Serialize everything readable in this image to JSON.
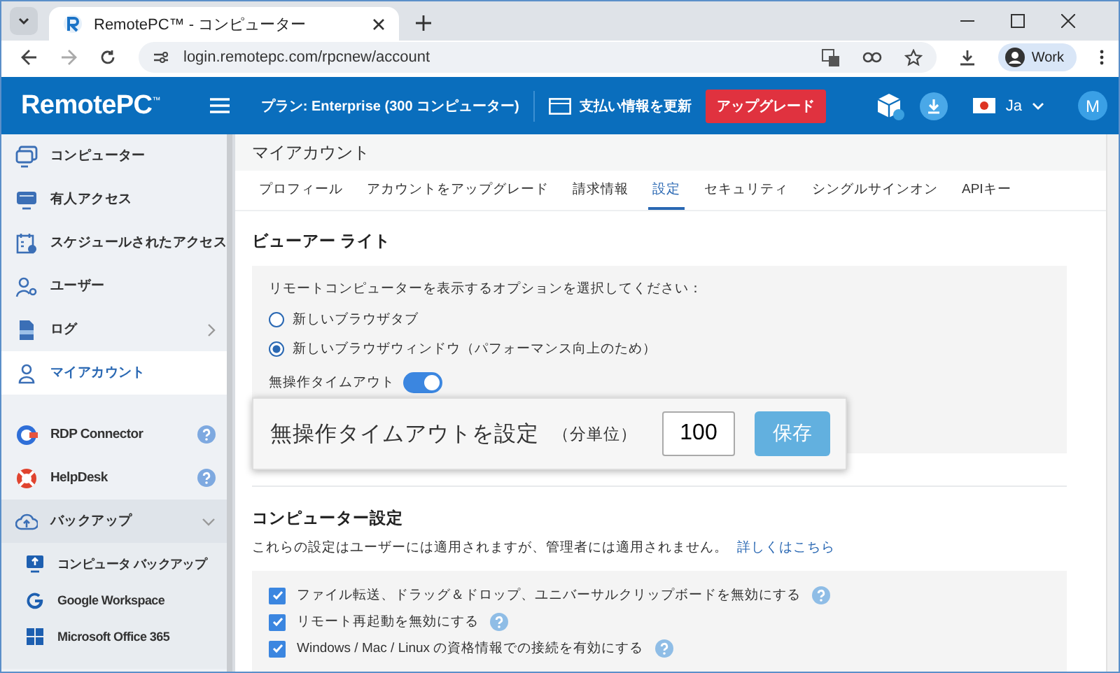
{
  "browser": {
    "tab_title": "RemotePC™ - コンピューター",
    "url": "login.remotepc.com/rpcnew/account",
    "profile": "Work"
  },
  "header": {
    "logo": "RemotePC",
    "logo_mark": "™",
    "plan": "プラン: Enterprise (300 コンピューター)",
    "billing": "支払い情報を更新",
    "upgrade": "アップグレード",
    "language": "Ja",
    "avatar": "M"
  },
  "sidebar": {
    "items": [
      {
        "label": "コンピューター",
        "selected": false
      },
      {
        "label": "有人アクセス",
        "selected": false
      },
      {
        "label": "スケジュールされたアクセス",
        "selected": false
      },
      {
        "label": "ユーザー",
        "selected": false
      },
      {
        "label": "ログ",
        "selected": false,
        "expanded": false
      },
      {
        "label": "マイアカウント",
        "selected": true
      },
      {
        "label": "RDP Connector",
        "selected": false,
        "help": true
      },
      {
        "label": "HelpDesk",
        "selected": false,
        "help": true
      },
      {
        "label": "バックアップ",
        "selected": false,
        "expanded": true,
        "children": [
          {
            "label": "コンピュータ バックアップ",
            "selected": false
          },
          {
            "label": "Google Workspace",
            "selected": false
          },
          {
            "label": "Microsoft Office 365",
            "selected": false
          }
        ]
      }
    ]
  },
  "page_title": "マイアカウント",
  "tabs": [
    {
      "label": "プロフィール",
      "selected": false
    },
    {
      "label": "アカウントをアップグレード",
      "selected": false
    },
    {
      "label": "請求情報",
      "selected": false
    },
    {
      "label": "設定",
      "selected": true
    },
    {
      "label": "セキュリティ",
      "selected": false
    },
    {
      "label": "シングルサインオン",
      "selected": false
    },
    {
      "label": "APIキー",
      "selected": false
    }
  ],
  "viewer_lite": {
    "heading": "ビューアー ライト",
    "prompt": "リモートコンピューターを表示するオプションを選択してください：",
    "options": [
      {
        "label": "新しいブラウザタブ",
        "selected": false
      },
      {
        "label": "新しいブラウザウィンドウ（パフォーマンス向上のため）",
        "selected": true
      }
    ],
    "timeout_toggle": {
      "label": "無操作タイムアウト",
      "on": true
    }
  },
  "timeout_popup": {
    "label": "無操作タイムアウトを設定",
    "unit": "（分単位）",
    "value": "100",
    "save": "保存"
  },
  "computer_settings": {
    "heading": "コンピューター設定",
    "description": "これらの設定はユーザーには適用されますが、管理者には適用されません。",
    "link": "詳しくはこちら",
    "options": [
      {
        "label": "ファイル転送、ドラッグ＆ドロップ、ユニバーサルクリップボードを無効にする",
        "checked": true
      },
      {
        "label": "リモート再起動を無効にする",
        "checked": true
      },
      {
        "label": "Windows / Mac / Linux の資格情報での接続を有効にする",
        "checked": true
      }
    ]
  }
}
